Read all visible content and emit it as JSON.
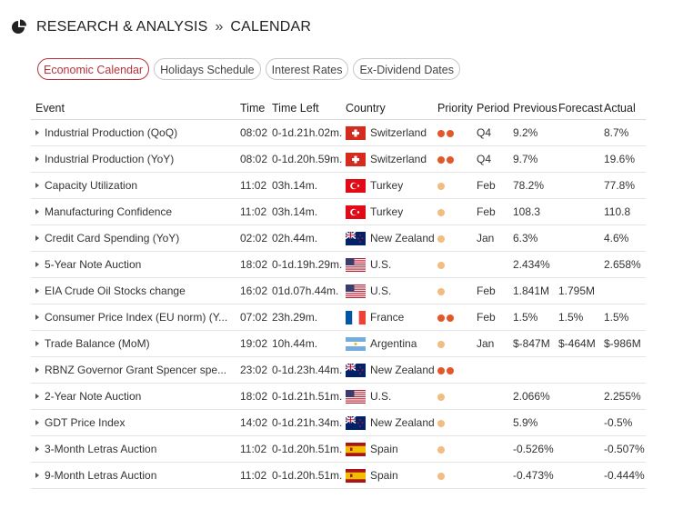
{
  "breadcrumb": {
    "section": "RESEARCH & ANALYSIS",
    "separator": "»",
    "page": "CALENDAR"
  },
  "tabs": [
    {
      "label": "Economic Calendar",
      "active": true
    },
    {
      "label": "Holidays Schedule",
      "active": false
    },
    {
      "label": "Interest Rates",
      "active": false
    },
    {
      "label": "Ex-Dividend Dates",
      "active": false
    }
  ],
  "colors": {
    "accent": "#b8323a",
    "priority_high": "#e2582b",
    "priority_low": "#f2bd80"
  },
  "table": {
    "headers": [
      "Event",
      "Time",
      "Time Left",
      "Country",
      "Priority",
      "Period",
      "Previous",
      "Forecast",
      "Actual"
    ],
    "rows": [
      {
        "event": "Industrial Production (QoQ)",
        "time": "08:02",
        "time_left": "0-1d.21h.02m.",
        "country": "Switzerland",
        "flag": "ch",
        "priority": 2,
        "period": "Q4",
        "previous": "9.2%",
        "forecast": "",
        "actual": "8.7%"
      },
      {
        "event": "Industrial Production (YoY)",
        "time": "08:02",
        "time_left": "0-1d.20h.59m.",
        "country": "Switzerland",
        "flag": "ch",
        "priority": 2,
        "period": "Q4",
        "previous": "9.7%",
        "forecast": "",
        "actual": "19.6%"
      },
      {
        "event": "Capacity Utilization",
        "time": "11:02",
        "time_left": "03h.14m.",
        "country": "Turkey",
        "flag": "tr",
        "priority": 1,
        "period": "Feb",
        "previous": "78.2%",
        "forecast": "",
        "actual": "77.8%"
      },
      {
        "event": "Manufacturing Confidence",
        "time": "11:02",
        "time_left": "03h.14m.",
        "country": "Turkey",
        "flag": "tr",
        "priority": 1,
        "period": "Feb",
        "previous": "108.3",
        "forecast": "",
        "actual": "110.8"
      },
      {
        "event": "Credit Card Spending (YoY)",
        "time": "02:02",
        "time_left": "02h.44m.",
        "country": "New Zealand",
        "flag": "nz",
        "priority": 1,
        "period": "Jan",
        "previous": "6.3%",
        "forecast": "",
        "actual": "4.6%"
      },
      {
        "event": "5-Year Note Auction",
        "time": "18:02",
        "time_left": "0-1d.19h.29m.",
        "country": "U.S.",
        "flag": "us",
        "priority": 1,
        "period": "",
        "previous": "2.434%",
        "forecast": "",
        "actual": "2.658%"
      },
      {
        "event": "EIA Crude Oil Stocks change",
        "time": "16:02",
        "time_left": "01d.07h.44m.",
        "country": "U.S.",
        "flag": "us",
        "priority": 1,
        "period": "Feb",
        "previous": "1.841M",
        "forecast": "1.795M",
        "actual": ""
      },
      {
        "event": "Consumer Price Index (EU norm) (Y...",
        "time": "07:02",
        "time_left": "23h.29m.",
        "country": "France",
        "flag": "fr",
        "priority": 2,
        "period": "Feb",
        "previous": "1.5%",
        "forecast": "1.5%",
        "actual": "1.5%"
      },
      {
        "event": "Trade Balance (MoM)",
        "time": "19:02",
        "time_left": "10h.44m.",
        "country": "Argentina",
        "flag": "ar",
        "priority": 1,
        "period": "Jan",
        "previous": "$-847M",
        "forecast": "$-464M",
        "actual": "$-986M"
      },
      {
        "event": "RBNZ Governor Grant Spencer spe...",
        "time": "23:02",
        "time_left": "0-1d.23h.44m.",
        "country": "New Zealand",
        "flag": "nz",
        "priority": 2,
        "period": "",
        "previous": "",
        "forecast": "",
        "actual": ""
      },
      {
        "event": "2-Year Note Auction",
        "time": "18:02",
        "time_left": "0-1d.21h.51m.",
        "country": "U.S.",
        "flag": "us",
        "priority": 1,
        "period": "",
        "previous": "2.066%",
        "forecast": "",
        "actual": "2.255%"
      },
      {
        "event": "GDT Price Index",
        "time": "14:02",
        "time_left": "0-1d.21h.34m.",
        "country": "New Zealand",
        "flag": "nz",
        "priority": 1,
        "period": "",
        "previous": "5.9%",
        "forecast": "",
        "actual": "-0.5%"
      },
      {
        "event": "3-Month Letras Auction",
        "time": "11:02",
        "time_left": "0-1d.20h.51m.",
        "country": "Spain",
        "flag": "es",
        "priority": 1,
        "period": "",
        "previous": "-0.526%",
        "forecast": "",
        "actual": "-0.507%"
      },
      {
        "event": "9-Month Letras Auction",
        "time": "11:02",
        "time_left": "0-1d.20h.51m.",
        "country": "Spain",
        "flag": "es",
        "priority": 1,
        "period": "",
        "previous": "-0.473%",
        "forecast": "",
        "actual": "-0.444%"
      }
    ]
  }
}
